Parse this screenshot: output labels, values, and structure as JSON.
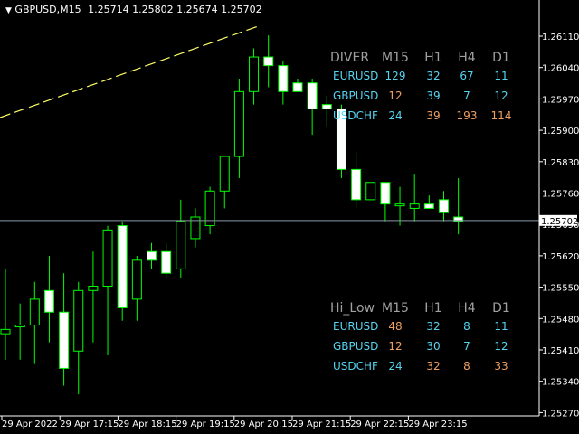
{
  "header": {
    "collapse_glyph": "▼",
    "symbol_tf": "GBPUSD,M15",
    "ohlc": "1.25714 1.25802 1.25674 1.25702"
  },
  "price_axis": {
    "labels": [
      "1.26110",
      "1.26040",
      "1.25970",
      "1.25900",
      "1.25830",
      "1.25760",
      "1.25690",
      "1.25620",
      "1.25550",
      "1.25480",
      "1.25410",
      "1.25340",
      "1.25270"
    ],
    "current_price": "1.25702"
  },
  "time_axis": {
    "labels": [
      "29 Apr 2022",
      "29 Apr 17:15",
      "29 Apr 18:15",
      "29 Apr 19:15",
      "29 Apr 20:15",
      "29 Apr 21:15",
      "29 Apr 22:15",
      "29 Apr 23:15"
    ]
  },
  "table_diver": {
    "title": "DIVER",
    "columns": [
      "M15",
      "H1",
      "H4",
      "D1"
    ],
    "rows": [
      {
        "pair": "EURUSD",
        "values": [
          "129",
          "32",
          "67",
          "11"
        ],
        "colors": [
          "#55d4f0",
          "#55d4f0",
          "#55d4f0",
          "#55d4f0"
        ]
      },
      {
        "pair": "GBPUSD",
        "values": [
          "12",
          "39",
          "7",
          "12"
        ],
        "colors": [
          "#f0a060",
          "#55d4f0",
          "#55d4f0",
          "#55d4f0"
        ]
      },
      {
        "pair": "USDCHF",
        "values": [
          "24",
          "39",
          "193",
          "114"
        ],
        "colors": [
          "#55d4f0",
          "#f0a060",
          "#f0a060",
          "#f0a060"
        ]
      }
    ]
  },
  "table_hilow": {
    "title": "Hi_Low",
    "columns": [
      "M15",
      "H1",
      "H4",
      "D1"
    ],
    "rows": [
      {
        "pair": "EURUSD",
        "values": [
          "48",
          "32",
          "8",
          "11"
        ],
        "colors": [
          "#f0a060",
          "#55d4f0",
          "#55d4f0",
          "#55d4f0"
        ]
      },
      {
        "pair": "GBPUSD",
        "values": [
          "12",
          "30",
          "7",
          "12"
        ],
        "colors": [
          "#f0a060",
          "#55d4f0",
          "#55d4f0",
          "#55d4f0"
        ]
      },
      {
        "pair": "USDCHF",
        "values": [
          "24",
          "32",
          "8",
          "33"
        ],
        "colors": [
          "#55d4f0",
          "#f0a060",
          "#f0a060",
          "#f0a060"
        ]
      }
    ]
  },
  "colors": {
    "background": "#000000",
    "candle_outline": "#00ff00",
    "bull_fill": "#000000",
    "bear_fill": "#ffffff",
    "trendline": "#ffff66",
    "bid_line": "#8a9aa8",
    "axis_text": "#ffffff",
    "header_title": "#a0a0a0",
    "pair_text": "#55d4f0"
  },
  "chart_data": {
    "type": "candlestick",
    "symbol": "GBPUSD",
    "timeframe": "M15",
    "y_range": [
      1.2525,
      1.2617
    ],
    "candles": [
      {
        "o": 1.2544,
        "h": 1.2559,
        "l": 1.2538,
        "c": 1.2545
      },
      {
        "o": 1.2546,
        "h": 1.2551,
        "l": 1.2538,
        "c": 1.2546
      },
      {
        "o": 1.2546,
        "h": 1.2556,
        "l": 1.2537,
        "c": 1.2552
      },
      {
        "o": 1.2554,
        "h": 1.2562,
        "l": 1.2542,
        "c": 1.2549
      },
      {
        "o": 1.2549,
        "h": 1.2558,
        "l": 1.2532,
        "c": 1.2536
      },
      {
        "o": 1.254,
        "h": 1.2556,
        "l": 1.253,
        "c": 1.2554
      },
      {
        "o": 1.2554,
        "h": 1.2563,
        "l": 1.2542,
        "c": 1.2555
      },
      {
        "o": 1.2555,
        "h": 1.2569,
        "l": 1.2539,
        "c": 1.2568
      },
      {
        "o": 1.2569,
        "h": 1.257,
        "l": 1.2547,
        "c": 1.255
      },
      {
        "o": 1.2552,
        "h": 1.2562,
        "l": 1.2547,
        "c": 1.2561
      },
      {
        "o": 1.2563,
        "h": 1.2565,
        "l": 1.2559,
        "c": 1.2561
      },
      {
        "o": 1.2563,
        "h": 1.2565,
        "l": 1.2557,
        "c": 1.2558
      },
      {
        "o": 1.2559,
        "h": 1.2575,
        "l": 1.2557,
        "c": 1.257
      },
      {
        "o": 1.2566,
        "h": 1.2573,
        "l": 1.2564,
        "c": 1.2571
      },
      {
        "o": 1.2569,
        "h": 1.2578,
        "l": 1.2567,
        "c": 1.2577
      },
      {
        "o": 1.2577,
        "h": 1.2579,
        "l": 1.2573,
        "c": 1.2585
      },
      {
        "o": 1.2585,
        "h": 1.2603,
        "l": 1.258,
        "c": 1.26
      },
      {
        "o": 1.26,
        "h": 1.261,
        "l": 1.2597,
        "c": 1.2608
      },
      {
        "o": 1.2608,
        "h": 1.2613,
        "l": 1.2601,
        "c": 1.2606
      },
      {
        "o": 1.2606,
        "h": 1.2607,
        "l": 1.2597,
        "c": 1.26
      },
      {
        "o": 1.2602,
        "h": 1.2603,
        "l": 1.26,
        "c": 1.26
      },
      {
        "o": 1.2602,
        "h": 1.2603,
        "l": 1.259,
        "c": 1.2596
      },
      {
        "o": 1.2597,
        "h": 1.2599,
        "l": 1.2592,
        "c": 1.2596
      },
      {
        "o": 1.2596,
        "h": 1.2597,
        "l": 1.258,
        "c": 1.2582
      },
      {
        "o": 1.2582,
        "h": 1.2586,
        "l": 1.2573,
        "c": 1.2575
      },
      {
        "o": 1.2575,
        "h": 1.2579,
        "l": 1.2575,
        "c": 1.2579
      },
      {
        "o": 1.2579,
        "h": 1.2579,
        "l": 1.257,
        "c": 1.2574
      },
      {
        "o": 1.2574,
        "h": 1.2578,
        "l": 1.2569,
        "c": 1.2574
      },
      {
        "o": 1.2573,
        "h": 1.2581,
        "l": 1.257,
        "c": 1.2574
      },
      {
        "o": 1.2574,
        "h": 1.2576,
        "l": 1.2573,
        "c": 1.2573
      },
      {
        "o": 1.2575,
        "h": 1.2577,
        "l": 1.257,
        "c": 1.2572
      },
      {
        "o": 1.2571,
        "h": 1.258,
        "l": 1.2567,
        "c": 1.257
      }
    ],
    "current_price": 1.25702,
    "trendline": {
      "from_index": 0,
      "to_index": 17
    }
  }
}
